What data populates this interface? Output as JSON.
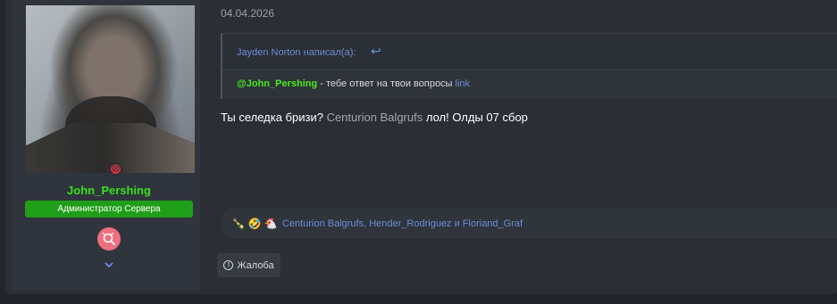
{
  "post": {
    "date": "04.04.2026"
  },
  "user": {
    "name": "John_Pershing",
    "role": "Администратор Сервера"
  },
  "quote": {
    "author_line": "Jayden Norton написал(а):",
    "mention": "@John_Pershing",
    "text": " - тебе ответ на твои вопросы ",
    "link": "link"
  },
  "message": {
    "text_before": "Ты селедка бризи? ",
    "mention": "Centurion Balgrufs",
    "text_after": " лол! Олды 07 сбор"
  },
  "reactions": {
    "icons": [
      "party-icon",
      "laugh-icon",
      "rooster-icon"
    ],
    "users": "Centurion Balgrufs, Hender_Rodriguez и Floriand_Graf"
  },
  "actions": {
    "report": "Жалоба"
  },
  "colors": {
    "background": "#22252b",
    "panel": "#2b2e35",
    "user_panel": "#30343c",
    "accent_green": "#38e21a",
    "link_blue": "#6b8dd8",
    "status_red": "#e0343b"
  }
}
